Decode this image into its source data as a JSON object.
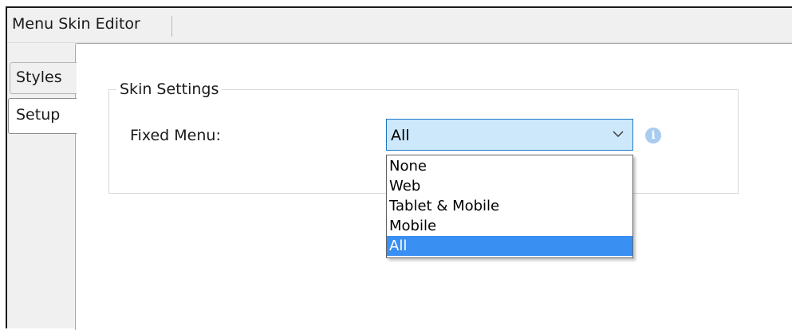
{
  "window": {
    "title": "Menu Skin Editor"
  },
  "tabs": [
    {
      "label": "Styles",
      "selected": false
    },
    {
      "label": "Setup",
      "selected": true
    }
  ],
  "skin_settings": {
    "legend": "Skin Settings",
    "fixed_menu": {
      "label": "Fixed Menu:",
      "value": "All",
      "options": [
        "None",
        "Web",
        "Tablet & Mobile",
        "Mobile",
        "All"
      ],
      "expanded": true
    },
    "info_icon": "info-icon"
  },
  "colors": {
    "select_bg": "#cde8fb",
    "select_border": "#1d78c8",
    "highlight": "#3a8ff2",
    "info_icon": "#a8cbf0"
  }
}
